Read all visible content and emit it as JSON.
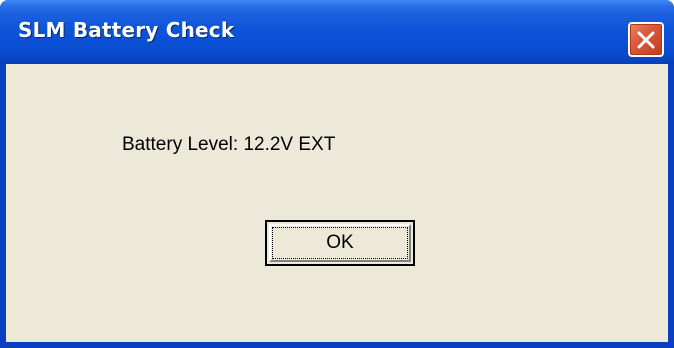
{
  "window": {
    "title": "SLM Battery Check",
    "close_icon": "close-icon"
  },
  "dialog": {
    "message": "Battery Level: 12.2V EXT",
    "ok_label": "OK"
  },
  "colors": {
    "titlebar": "#0a4fd3",
    "client_background": "#ece9d8",
    "close_button": "#d9593b"
  }
}
